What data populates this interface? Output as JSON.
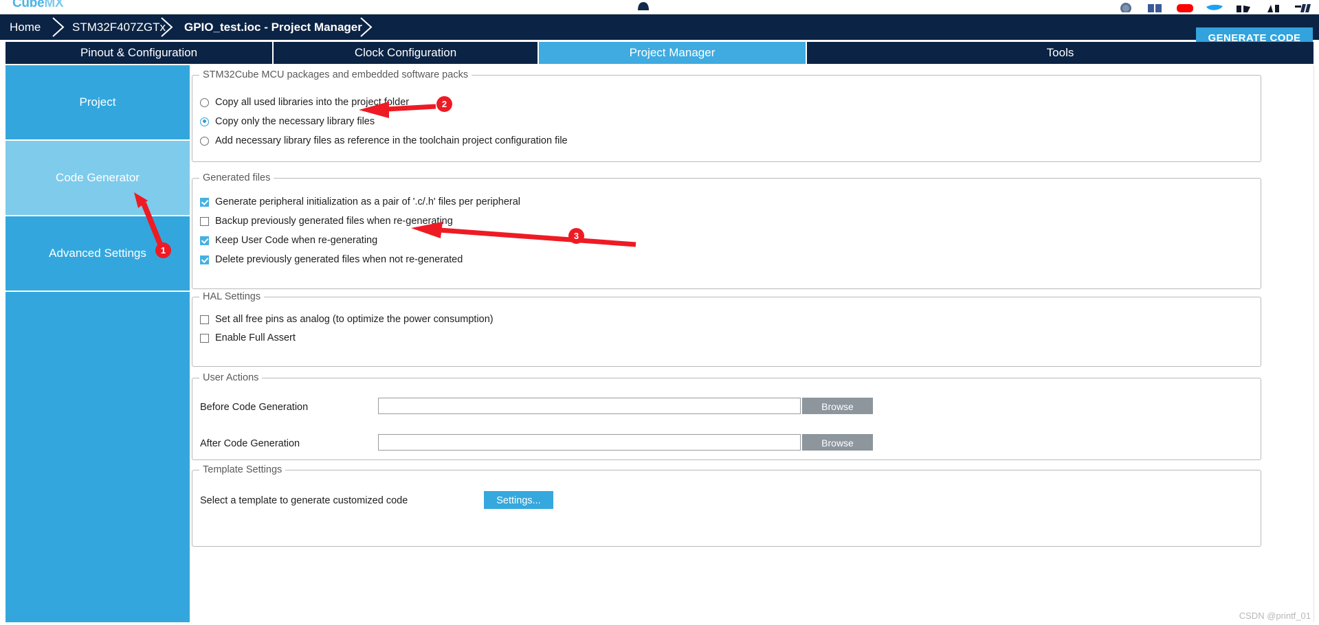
{
  "app": {
    "logo_text": "Cube",
    "logo_text_2": "MX",
    "watermark": "CSDN @printf_01"
  },
  "social_icons": [
    {
      "name": "st-community-icon"
    },
    {
      "name": "facebook-icon"
    },
    {
      "name": "youtube-icon"
    },
    {
      "name": "twitter-icon"
    },
    {
      "name": "linkedin-icon"
    },
    {
      "name": "instagram-icon"
    },
    {
      "name": "blog-icon"
    }
  ],
  "breadcrumb": {
    "items": [
      {
        "label": "Home",
        "bold": false
      },
      {
        "label": "STM32F407ZGTx",
        "bold": false
      },
      {
        "label": "GPIO_test.ioc - Project Manager",
        "bold": true
      }
    ],
    "generate_code_label": "GENERATE CODE"
  },
  "tabs": [
    {
      "label": "Pinout & Configuration",
      "active": false
    },
    {
      "label": "Clock Configuration",
      "active": false
    },
    {
      "label": "Project Manager",
      "active": true
    },
    {
      "label": "Tools",
      "active": false
    }
  ],
  "sidebar": {
    "items": [
      {
        "label": "Project",
        "selected": false
      },
      {
        "label": "Code Generator",
        "selected": true
      },
      {
        "label": "Advanced Settings",
        "selected": false
      }
    ]
  },
  "groups": {
    "mcu_packages": {
      "title": "STM32Cube MCU packages and embedded software packs",
      "options": [
        {
          "label": "Copy all used libraries into the project folder",
          "checked": false
        },
        {
          "label": "Copy only the necessary library files",
          "checked": true
        },
        {
          "label": "Add necessary library files as reference in the toolchain project configuration file",
          "checked": false
        }
      ]
    },
    "generated_files": {
      "title": "Generated files",
      "options": [
        {
          "label": "Generate peripheral initialization as a pair of '.c/.h' files per peripheral",
          "checked": true
        },
        {
          "label": "Backup previously generated files when re-generating",
          "checked": false
        },
        {
          "label": "Keep User Code when re-generating",
          "checked": true
        },
        {
          "label": "Delete previously generated files when not re-generated",
          "checked": true
        }
      ]
    },
    "hal_settings": {
      "title": "HAL Settings",
      "options": [
        {
          "label": "Set all free pins as analog (to optimize the power consumption)",
          "checked": false
        },
        {
          "label": "Enable Full Assert",
          "checked": false
        }
      ]
    },
    "user_actions": {
      "title": "User Actions",
      "rows": [
        {
          "label": "Before Code Generation",
          "value": "",
          "placeholder": "",
          "button": "Browse"
        },
        {
          "label": "After Code Generation",
          "value": "",
          "placeholder": "",
          "button": "Browse"
        }
      ]
    },
    "template_settings": {
      "title": "Template Settings",
      "description": "Select a template to generate customized code",
      "button": "Settings..."
    }
  },
  "annotations": [
    {
      "id": "1",
      "number": "1"
    },
    {
      "id": "2",
      "number": "2"
    },
    {
      "id": "3",
      "number": "3"
    }
  ],
  "colors": {
    "brand_dark": "#0b2344",
    "brand_blue": "#33a7dd",
    "brand_blue_light": "#7ecbec",
    "accent": "#32a3dd",
    "annotation_red": "#ee1b24"
  }
}
